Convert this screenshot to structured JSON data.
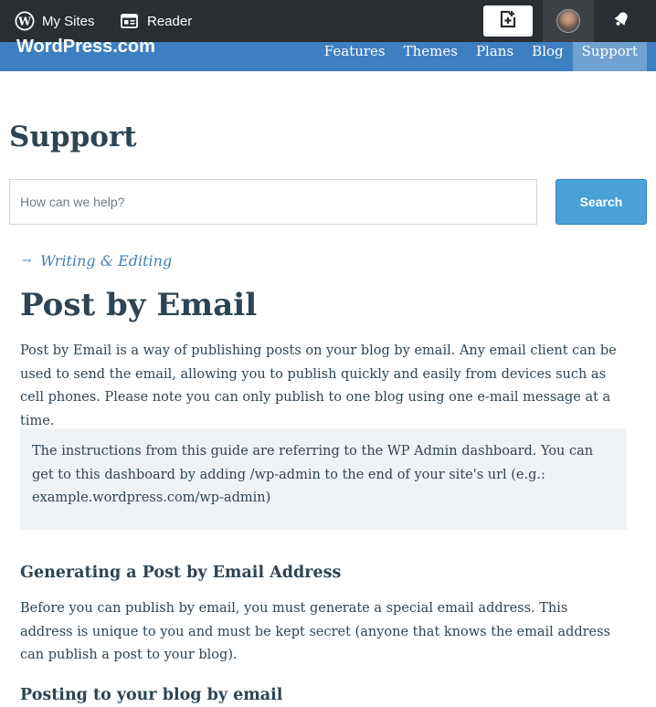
{
  "masterbar": {
    "my_sites_label": "My Sites",
    "reader_label": "Reader",
    "icons": {
      "wordpress": "wordpress-icon",
      "reader": "reader-icon",
      "write": "write-post-icon",
      "notifications": "notifications-bell-icon"
    }
  },
  "header": {
    "logo": "WordPress.com",
    "nav": [
      {
        "label": "Features"
      },
      {
        "label": "Themes"
      },
      {
        "label": "Plans"
      },
      {
        "label": "Blog"
      },
      {
        "label": "Support",
        "active": true
      }
    ]
  },
  "support": {
    "title": "Support",
    "search_placeholder": "How can we help?",
    "search_button": "Search"
  },
  "article": {
    "breadcrumb": "Writing & Editing",
    "title": "Post by Email",
    "intro": "Post by Email is a way of publishing posts on your blog by email. Any email client can be used to send the email, allowing you to publish quickly and easily from devices such as cell phones. Please note you can only publish to one blog using one e-mail message at a time.",
    "notice": "The instructions from this guide are referring to the WP Admin dashboard. You can get to this dashboard by adding /wp-admin to the end of your site's url (e.g.: example.wordpress.com/wp-admin)",
    "section1_heading": "Generating a Post by Email Address",
    "section1_text": "Before you can publish by email, you must generate a special email address. This address is unique to you and must be kept secret (anyone that knows the email address can publish a post to your blog).",
    "section2_heading": "Posting to your blog by email"
  },
  "colors": {
    "masterbar": "#2a2d32",
    "header_blue": "#3d7fc0",
    "active_nav": "#6fa1d1",
    "search_button": "#4aa1d8",
    "text": "#2e4453",
    "link": "#3f7fb7",
    "notice_bg": "#f0f3f6"
  }
}
